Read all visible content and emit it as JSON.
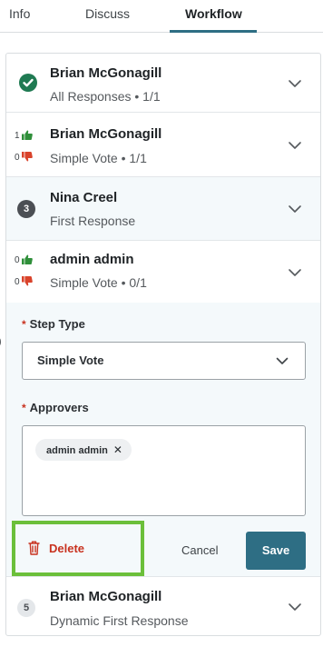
{
  "tabs": [
    {
      "label": "Info",
      "active": false
    },
    {
      "label": "Discuss",
      "active": false
    },
    {
      "label": "Workflow",
      "active": true
    }
  ],
  "steps": [
    {
      "name": "Brian McGonagill",
      "subtitle": "All Responses • 1/1",
      "status": "complete"
    },
    {
      "name": "Brian McGonagill",
      "subtitle": "Simple Vote • 1/1",
      "votes_up": "1",
      "votes_down": "0"
    },
    {
      "name": "Nina Creel",
      "subtitle": "First Response",
      "number": "3"
    },
    {
      "name": "admin admin",
      "subtitle": "Simple Vote • 0/1",
      "votes_up": "0",
      "votes_down": "0"
    },
    {
      "name": "Brian McGonagill",
      "subtitle": "Dynamic First Response",
      "number": "5"
    }
  ],
  "editor": {
    "step_type_label": "Step Type",
    "step_type_value": "Simple Vote",
    "approvers_label": "Approvers",
    "approvers": [
      "admin admin"
    ],
    "required_marker": "*",
    "delete_label": "Delete",
    "cancel_label": "Cancel",
    "save_label": "Save"
  },
  "colors": {
    "accent": "#2e6e84",
    "complete": "#1f7a52",
    "thumbs_up": "#2f8f3a",
    "thumbs_down": "#d9432b",
    "delete": "#c8321f",
    "highlight": "#6bbf3a",
    "row_tint": "#f4f9fb"
  },
  "edge_mark": ")"
}
